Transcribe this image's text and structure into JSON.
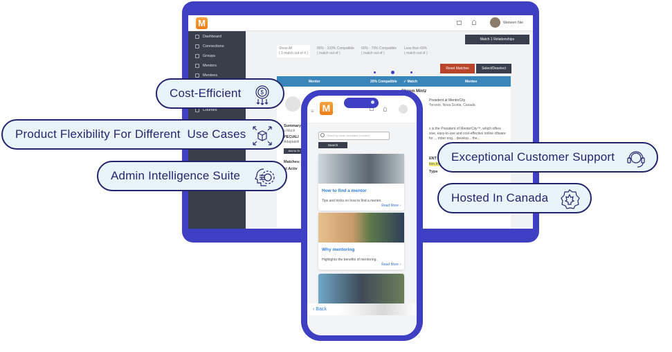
{
  "tablet": {
    "user_name": "Weiwen Nie",
    "logo_letter": "M",
    "sidebar": [
      "Dashboard",
      "Connections",
      "Groups",
      "Mentors",
      "Mentees",
      "Courses"
    ],
    "match_button": "Match 1 Relationships",
    "tabs": [
      {
        "label": "Show All",
        "sub": "( 1 match out of 4 )"
      },
      {
        "label": "80% - 100% Compatible",
        "sub": "( match out of )"
      },
      {
        "label": "60% - 79% Compatible",
        "sub": "( match out of )"
      },
      {
        "label": "Less than 60%",
        "sub": "( match out of )"
      }
    ],
    "reset_button": "Reset Matches",
    "select_button": "Select/Deselect",
    "table_header": {
      "mentor": "Mentor",
      "compat": "20% Compatible",
      "match": "Match",
      "mentee": "Mentee"
    },
    "mentee": {
      "name": "Shawn Mintz",
      "title": "President at MentorCity",
      "location": "Toronto, Nova Scotia, Canada",
      "bio": "z is the President of MentorCity™, which offers sive, easy-to-use and cost-effective online oftware for ... mber eng... develop... the...",
      "section": "ENT AR",
      "tags": "tion,Innovati",
      "type_label": "Type"
    },
    "mentor": {
      "summary": "Summary",
      "summary_val": "o Much",
      "special": "PECIALI",
      "special_val": "Adaptabili",
      "add_button": "Add to Gr",
      "matches": "Matches:",
      "last": "st Activ"
    }
  },
  "phone": {
    "logo_letter": "M",
    "search_placeholder": "Search by name, description or content",
    "search_button": "Search",
    "cards": [
      {
        "title": "How to find a mentor",
        "desc": "Tips and tricks on how to find a mentor.",
        "more": "Read More ›"
      },
      {
        "title": "Why mentoring",
        "desc": "Highlights the benefits of mentoring.",
        "more": "Read More ›"
      }
    ],
    "back": "Back"
  },
  "features": [
    "Cost-Efficient",
    "Product Flexibility For Different  Use Cases",
    "Admin Intelligence Suite",
    "Exceptional Customer Support",
    "Hosted In Canada"
  ],
  "colors": {
    "frame": "#3e3fc2",
    "pill_bg": "#e7f4fa",
    "pill_text": "#25256e",
    "table_header": "#3a85b9",
    "reset": "#b8452b",
    "link": "#2f7de1"
  }
}
